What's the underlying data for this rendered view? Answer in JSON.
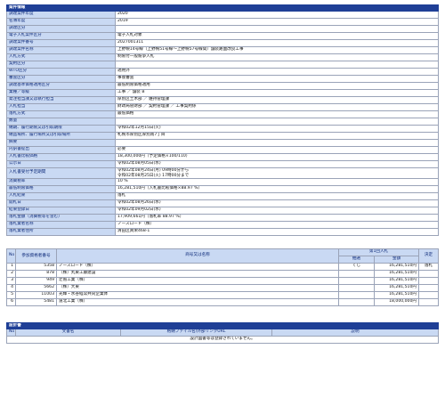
{
  "info": {
    "header": "案件情報",
    "rows": [
      {
        "label": "調達案件年度",
        "value": "2020"
      },
      {
        "label": "名簿年度",
        "value": "2019"
      },
      {
        "label": "調達区分",
        "value": ""
      },
      {
        "label": "電子入札案件区分",
        "value": "電子入札対象"
      },
      {
        "label": "調達案件番号",
        "value": "2027001311"
      },
      {
        "label": "調達案件名称",
        "value": "上野幌14号線（上野幌51号線～上野幌57号線間）舗装路面改良工事"
      },
      {
        "label": "入札方式",
        "value": "制限付一般競争入札"
      },
      {
        "label": "契約区分",
        "value": ""
      },
      {
        "label": "WTO区分",
        "value": "適用外"
      },
      {
        "label": "審査区分",
        "value": "事後審査"
      },
      {
        "label": "調達基準価格適用区分",
        "value": "最低制限価格適用"
      },
      {
        "label": "業種／等級",
        "value": "工事 ／ 舗装 B"
      },
      {
        "label": "発注担当課又は執行担当",
        "value": "厚別区土木部 ／ 維持管理課"
      },
      {
        "label": "入札担当",
        "value": "財政局管財部 ／ 契約管理課 ／ 工事契約係"
      },
      {
        "label": "落札方式",
        "value": "最低価格"
      },
      {
        "label": "数量",
        "value": ""
      },
      {
        "label": "納期、履行期限又は引取期限",
        "value": "令和02年12月15日(火)"
      },
      {
        "label": "納品場所、履行場所又は引取場所",
        "value": "札幌市厚別区厚別南7丁目"
      },
      {
        "label": "摘要",
        "value": ""
      },
      {
        "label": "内訳書提出",
        "value": "必要"
      },
      {
        "label": "入札書比較価格",
        "value": "18,300,000円（予定価格×100/110）"
      },
      {
        "label": "公示日",
        "value": "令和02年08月05日(水)"
      },
      {
        "label": "入札書受付予定期間",
        "value": "令和02年08月24日(月) 09時00分から\n令和02年08月25日(火) 17時00分まで"
      },
      {
        "label": "消費税率",
        "value": "10 %"
      },
      {
        "label": "最低制限価格",
        "value": "16,281,510円（入札書比較価格×88.97 %）"
      },
      {
        "label": "入札結果",
        "value": "落札"
      },
      {
        "label": "開札日",
        "value": "令和02年08月26日(水)"
      },
      {
        "label": "結果登録日",
        "value": "令和02年09月02日(水)"
      },
      {
        "label": "落札金額（消費税等を含む）",
        "value": "17,909,661円（落札率 88.97 %）"
      },
      {
        "label": "落札業者名称",
        "value": "ノースロード（株）"
      },
      {
        "label": "落札業者住所",
        "value": "清田区真栄468-1"
      }
    ]
  },
  "results": {
    "headers": {
      "no": "No",
      "bidder_no": "参加資格者番号",
      "name": "商号又は名称",
      "round1": "第1回入札",
      "check": "抽選",
      "amount": "金額",
      "decision": "決定"
    },
    "rows": [
      {
        "no": "1",
        "bidder_no": "5358",
        "name": "ノースロード（株）",
        "check": "くじ",
        "amount": "16,281,510円",
        "decision": "落札"
      },
      {
        "no": "2",
        "bidder_no": "878",
        "name": "（株）丸東工藤建設",
        "check": "",
        "amount": "16,281,510円",
        "decision": ""
      },
      {
        "no": "3",
        "bidder_no": "949",
        "name": "辻殖工業（株）",
        "check": "",
        "amount": "16,281,510円",
        "decision": ""
      },
      {
        "no": "4",
        "bidder_no": "5662",
        "name": "（株）大東",
        "check": "",
        "amount": "16,281,510円",
        "decision": ""
      },
      {
        "no": "5",
        "bidder_no": "11003",
        "name": "光輝・水谷経常共同企業体",
        "check": "",
        "amount": "16,281,510円",
        "decision": ""
      },
      {
        "no": "6",
        "bidder_no": "5481",
        "name": "道北工業（株）",
        "check": "",
        "amount": "18,000,000円",
        "decision": ""
      }
    ]
  },
  "docs": {
    "header": "設計書",
    "headers": {
      "no": "No",
      "doc_name": "文書名",
      "file": "格納ファイル名/外部リンクURL",
      "desc": "説明"
    },
    "empty": "設計図書等は登録されていません。"
  }
}
